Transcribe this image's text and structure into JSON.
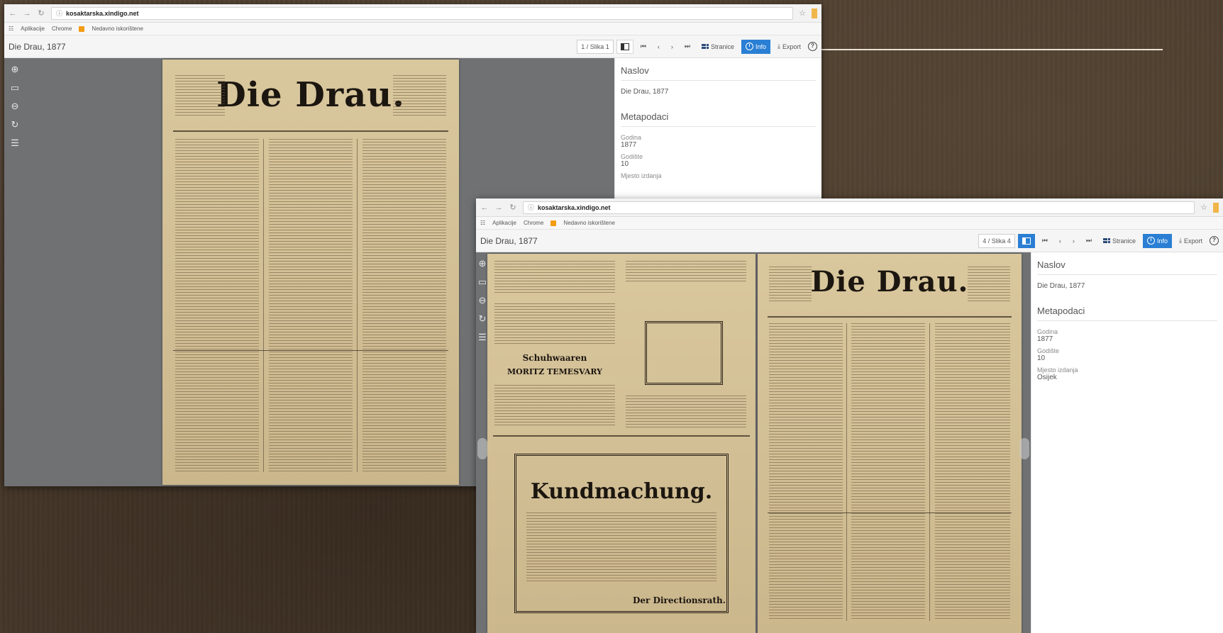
{
  "window1": {
    "url_host": "kosaktarska.xindigo.net",
    "bookmarks": [
      "Aplikacije",
      "Chrome",
      "Nedavno iskorištene"
    ],
    "title": "Die Drau, 1877",
    "page_indicator": "1 / Slika 1",
    "pages_label": "Stranice",
    "info_label": "Info",
    "export_label": "Export",
    "masthead": "Die Drau.",
    "info_panel": {
      "title_heading": "Naslov",
      "title_value": "Die Drau, 1877",
      "meta_heading": "Metapodaci",
      "year_label": "Godina",
      "year_value": "1877",
      "vol_label": "Godište",
      "vol_value": "10",
      "place_label": "Mjesto izdanja"
    }
  },
  "window2": {
    "url_host": "kosaktarska.xindigo.net",
    "bookmarks": [
      "Aplikacije",
      "Chrome",
      "Nedavno iskorištene"
    ],
    "title": "Die Drau, 1877",
    "page_indicator": "4 / Slika 4",
    "pages_label": "Stranice",
    "info_label": "Info",
    "export_label": "Export",
    "masthead": "Die Drau.",
    "left_page": {
      "ad_heading": "Schuhwaaren",
      "ad_name": "MORITZ TEMESVARY",
      "kundmachung": "Kundmachung.",
      "signature": "Der Directionsrath."
    },
    "info_panel": {
      "title_heading": "Naslov",
      "title_value": "Die Drau, 1877",
      "meta_heading": "Metapodaci",
      "year_label": "Godina",
      "year_value": "1877",
      "vol_label": "Godište",
      "vol_value": "10",
      "place_label": "Mjesto izdanja",
      "place_value": "Osijek"
    }
  },
  "colors": {
    "accent": "#2a7fd4",
    "viewer_bg": "#6f7173",
    "paper": "#d2bf95"
  },
  "icons": [
    "zoom-in-icon",
    "fullscreen-icon",
    "zoom-out-icon",
    "rotate-icon",
    "adjust-icon",
    "help-icon",
    "info-icon",
    "grid-icon",
    "download-icon"
  ]
}
